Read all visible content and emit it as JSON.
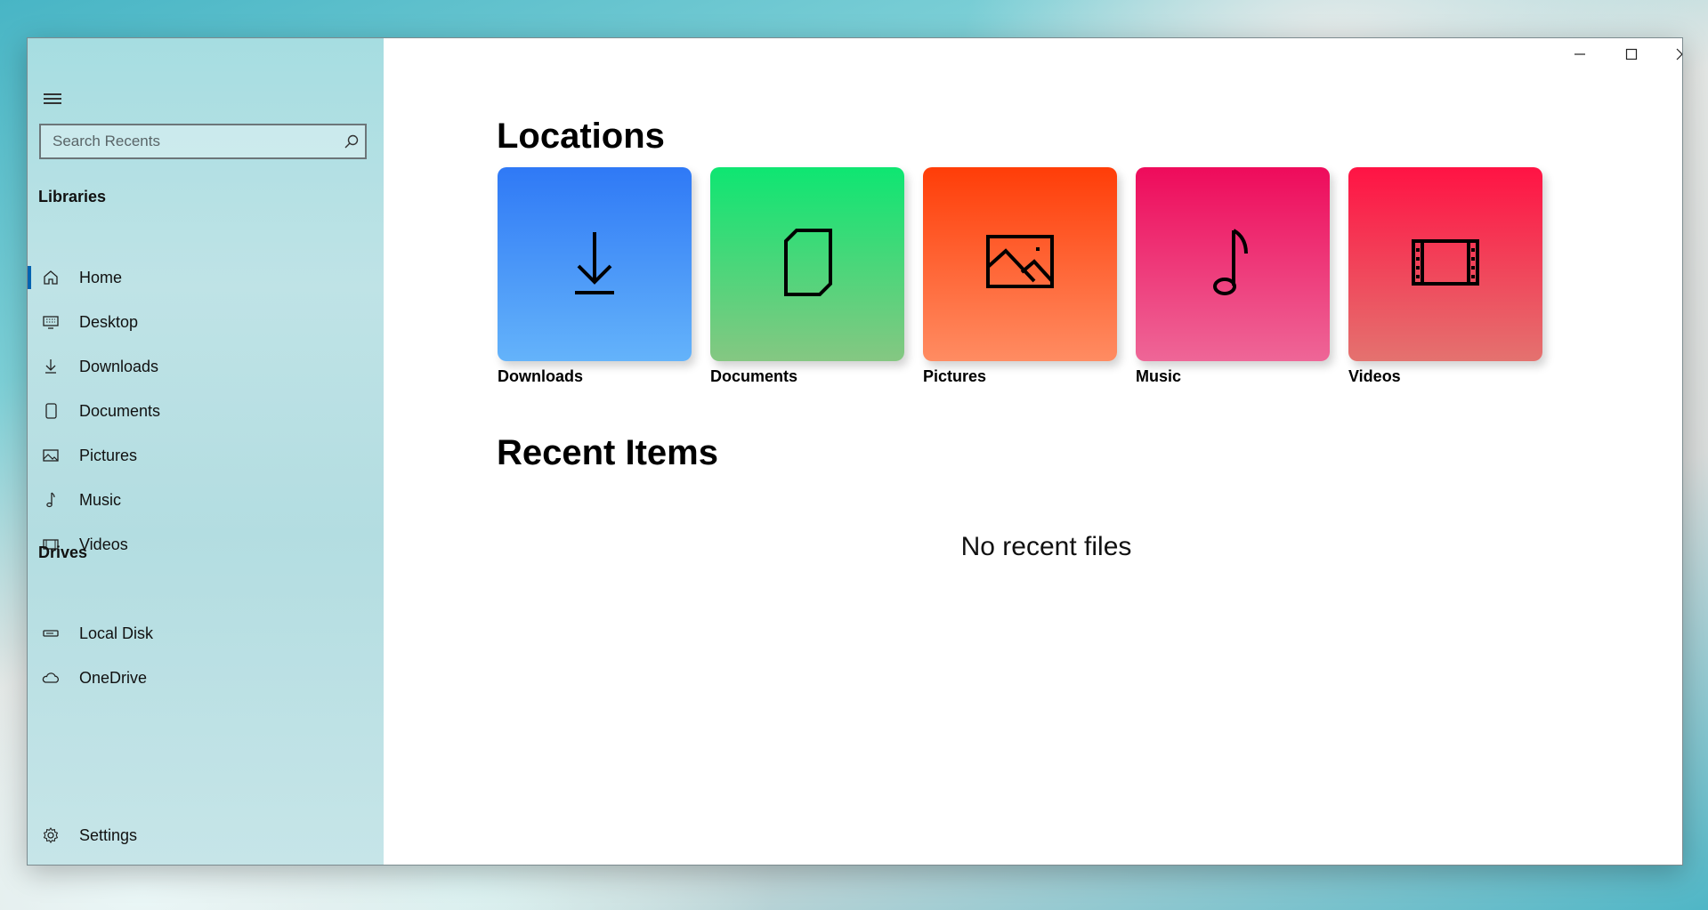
{
  "sidebar": {
    "search": {
      "placeholder": "Search Recents",
      "value": ""
    },
    "libraries_header": "Libraries",
    "drives_header": "Drives",
    "libraries": [
      {
        "label": "Home",
        "icon": "home-icon"
      },
      {
        "label": "Desktop",
        "icon": "desktop-icon"
      },
      {
        "label": "Downloads",
        "icon": "download-icon"
      },
      {
        "label": "Documents",
        "icon": "document-icon"
      },
      {
        "label": "Pictures",
        "icon": "picture-icon"
      },
      {
        "label": "Music",
        "icon": "music-note-icon"
      },
      {
        "label": "Videos",
        "icon": "video-icon"
      }
    ],
    "drives": [
      {
        "label": "Local Disk",
        "icon": "drive-icon"
      },
      {
        "label": "OneDrive",
        "icon": "cloud-icon"
      }
    ],
    "settings_label": "Settings",
    "active_item": "Home"
  },
  "main": {
    "locations_title": "Locations",
    "recent_title": "Recent Items",
    "empty_message": "No recent files",
    "locations": [
      {
        "label": "Downloads",
        "icon": "download-icon",
        "color_top": "#2f79f6",
        "color_bottom": "#64b3fa"
      },
      {
        "label": "Documents",
        "icon": "document-icon",
        "color_top": "#0ee672",
        "color_bottom": "#85c782"
      },
      {
        "label": "Pictures",
        "icon": "picture-icon",
        "color_top": "#ff3d08",
        "color_bottom": "#ff8c62"
      },
      {
        "label": "Music",
        "icon": "music-note-icon",
        "color_top": "#ee0b5b",
        "color_bottom": "#ee6697"
      },
      {
        "label": "Videos",
        "icon": "video-icon",
        "color_top": "#ff1344",
        "color_bottom": "#e4726f"
      }
    ]
  },
  "window_controls": [
    "minimize-icon",
    "maximize-icon",
    "close-icon"
  ]
}
